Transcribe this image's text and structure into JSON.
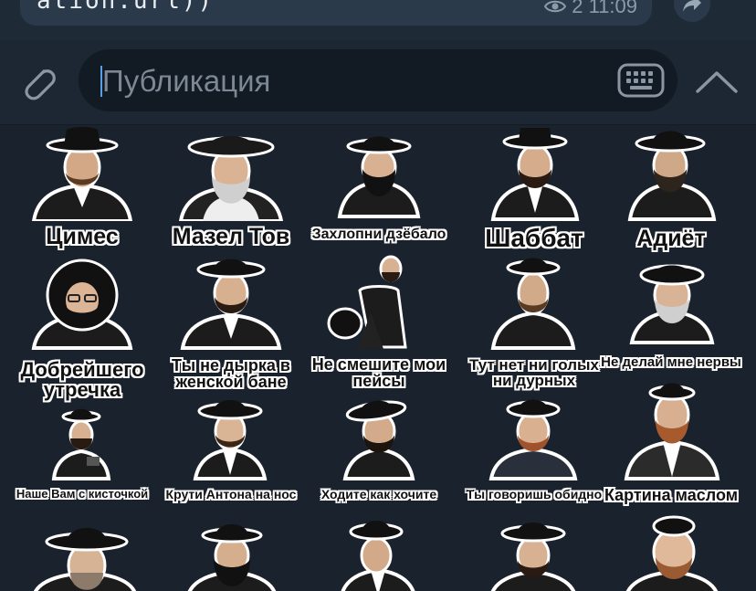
{
  "message": {
    "text_fragment": "ation.url))",
    "views_label": "2 11:09"
  },
  "input": {
    "placeholder": "Публикация"
  },
  "stickers": [
    {
      "caption": "Цимес"
    },
    {
      "caption": "Мазел Тов"
    },
    {
      "caption": "Захлопни дзёбало"
    },
    {
      "caption": "Шаббат"
    },
    {
      "caption": "Адиёт"
    },
    {
      "caption": "Добрейшего утречка"
    },
    {
      "caption": "Ты не дырка в женской бане"
    },
    {
      "caption": "Не смешите мои пейсы"
    },
    {
      "caption": "Тут нет ни голых ни дурных"
    },
    {
      "caption": "Не делай мне нервы"
    },
    {
      "caption": "Наше Вам с кисточкой"
    },
    {
      "caption": "Крути Антона на нос"
    },
    {
      "caption": "Ходите как хочите"
    },
    {
      "caption": "Ты говоришь обидно"
    },
    {
      "caption": "Картина маслом"
    },
    {
      "caption": ""
    },
    {
      "caption": ""
    },
    {
      "caption": ""
    },
    {
      "caption": ""
    },
    {
      "caption": ""
    }
  ],
  "colors": {
    "background": "#1a222e",
    "input_bar": "#1c2733",
    "field": "#121a23",
    "accent_cursor": "#5aa0e6"
  }
}
